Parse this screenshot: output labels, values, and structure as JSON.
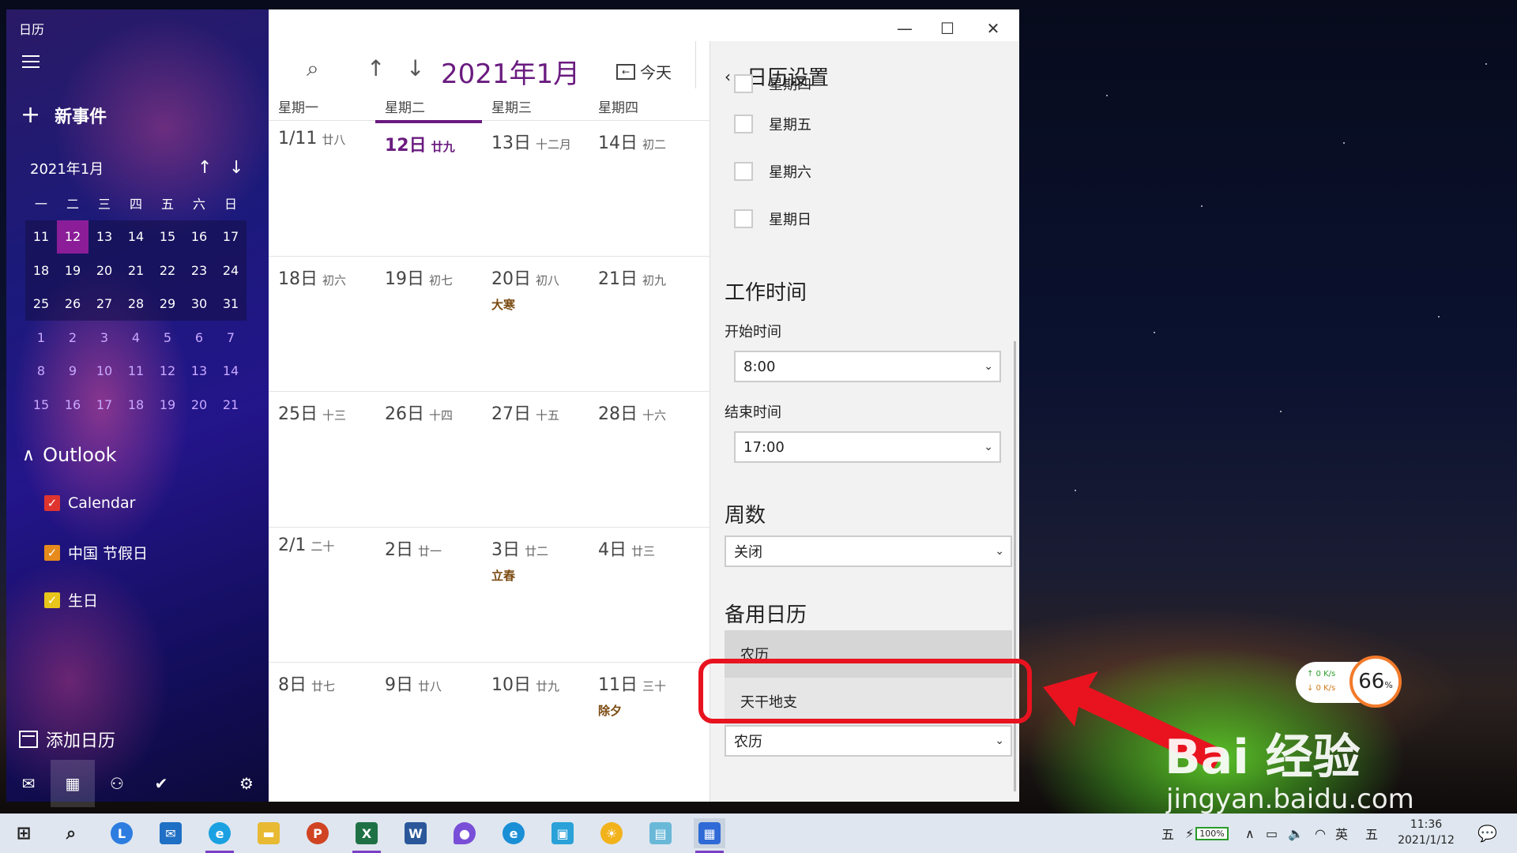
{
  "app": {
    "title": "日历",
    "new_event": "新事件",
    "add_calendar": "添加日历"
  },
  "window_controls": {
    "minimize": "—",
    "maximize": "☐",
    "close": "✕"
  },
  "mini_calendar": {
    "month_label": "2021年1月",
    "up": "↑",
    "down": "↓",
    "dow": [
      "一",
      "二",
      "三",
      "四",
      "五",
      "六",
      "日"
    ],
    "weeks": [
      [
        "11",
        "12",
        "13",
        "14",
        "15",
        "16",
        "17"
      ],
      [
        "18",
        "19",
        "20",
        "21",
        "22",
        "23",
        "24"
      ],
      [
        "25",
        "26",
        "27",
        "28",
        "29",
        "30",
        "31"
      ],
      [
        "1",
        "2",
        "3",
        "4",
        "5",
        "6",
        "7"
      ],
      [
        "8",
        "9",
        "10",
        "11",
        "12",
        "13",
        "14"
      ],
      [
        "15",
        "16",
        "17",
        "18",
        "19",
        "20",
        "21"
      ]
    ]
  },
  "accounts": {
    "group": "Outlook",
    "calendars": [
      {
        "label": "Calendar",
        "color": "#e0342f"
      },
      {
        "label": "中国 节假日",
        "color": "#e68a1c"
      },
      {
        "label": "生日",
        "color": "#e8c51a"
      }
    ]
  },
  "main": {
    "month_title": "2021年1月",
    "today_label": "今天",
    "today_icon_text": "←",
    "search_icon": "⌕",
    "up": "↑",
    "down": "↓",
    "dow": [
      "星期一",
      "星期二",
      "星期三",
      "星期四"
    ],
    "weeks": [
      [
        {
          "n": "1/11",
          "l": "廿八",
          "h": ""
        },
        {
          "n": "12日",
          "l": "廿九",
          "h": ""
        },
        {
          "n": "13日",
          "l": "十二月",
          "h": ""
        },
        {
          "n": "14日",
          "l": "初二",
          "h": ""
        }
      ],
      [
        {
          "n": "18日",
          "l": "初六",
          "h": ""
        },
        {
          "n": "19日",
          "l": "初七",
          "h": ""
        },
        {
          "n": "20日",
          "l": "初八",
          "h": "大寒"
        },
        {
          "n": "21日",
          "l": "初九",
          "h": ""
        }
      ],
      [
        {
          "n": "25日",
          "l": "十三",
          "h": ""
        },
        {
          "n": "26日",
          "l": "十四",
          "h": ""
        },
        {
          "n": "27日",
          "l": "十五",
          "h": ""
        },
        {
          "n": "28日",
          "l": "十六",
          "h": ""
        }
      ],
      [
        {
          "n": "2/1",
          "l": "二十",
          "h": ""
        },
        {
          "n": "2日",
          "l": "廿一",
          "h": ""
        },
        {
          "n": "3日",
          "l": "廿二",
          "h": "立春"
        },
        {
          "n": "4日",
          "l": "廿三",
          "h": ""
        }
      ],
      [
        {
          "n": "8日",
          "l": "廿七",
          "h": ""
        },
        {
          "n": "9日",
          "l": "廿八",
          "h": ""
        },
        {
          "n": "10日",
          "l": "廿九",
          "h": ""
        },
        {
          "n": "11日",
          "l": "三十",
          "h": "除夕"
        }
      ]
    ]
  },
  "settings": {
    "title": "日历设置",
    "back": "‹",
    "days": [
      "星期四",
      "星期五",
      "星期六",
      "星期日"
    ],
    "work_hours_title": "工作时间",
    "start_label": "开始时间",
    "start_value": "8:00",
    "end_label": "结束时间",
    "end_value": "17:00",
    "week_numbers_title": "周数",
    "week_numbers_value": "关闭",
    "alt_calendar_title": "备用日历",
    "alt_options": [
      "农历",
      "天干地支"
    ],
    "alt_behind_value": "农历",
    "arrow": "⌄"
  },
  "widget": {
    "up_speed": "↑ 0  K/s",
    "down_speed": "↓ 0  K/s",
    "percent": "66",
    "percent_sign": "%"
  },
  "watermark": {
    "brand": "Bai 经验",
    "url": "jingyan.baidu.com"
  },
  "taskbar": {
    "ime": "五",
    "battery": "100%",
    "lang": "英",
    "ime2": "五",
    "time": "11:36",
    "date": "2021/1/12"
  }
}
